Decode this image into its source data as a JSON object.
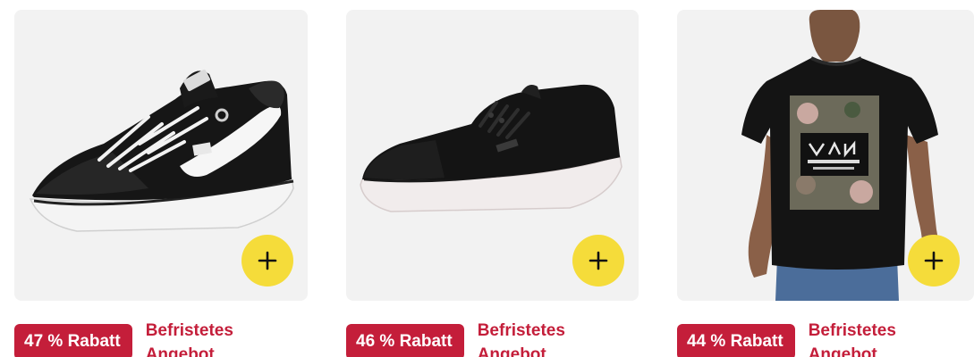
{
  "products": [
    {
      "image_name": "vans-filmore-sneaker-image",
      "discount_badge": "47 % Rabatt",
      "deal_label": "Befristetes Angebot",
      "add_icon": "plus-icon"
    },
    {
      "image_name": "vans-atwood-sneaker-image",
      "discount_badge": "46 % Rabatt",
      "deal_label": "Befristetes Angebot",
      "add_icon": "plus-icon"
    },
    {
      "image_name": "vans-print-tshirt-image",
      "discount_badge": "44 % Rabatt",
      "deal_label": "Befristetes Angebot",
      "add_icon": "plus-icon"
    }
  ],
  "colors": {
    "badge_bg": "#c41e3a",
    "deal_text": "#c41e3a",
    "add_button": "#f5dc3a",
    "tile_bg": "#f2f2f2"
  }
}
